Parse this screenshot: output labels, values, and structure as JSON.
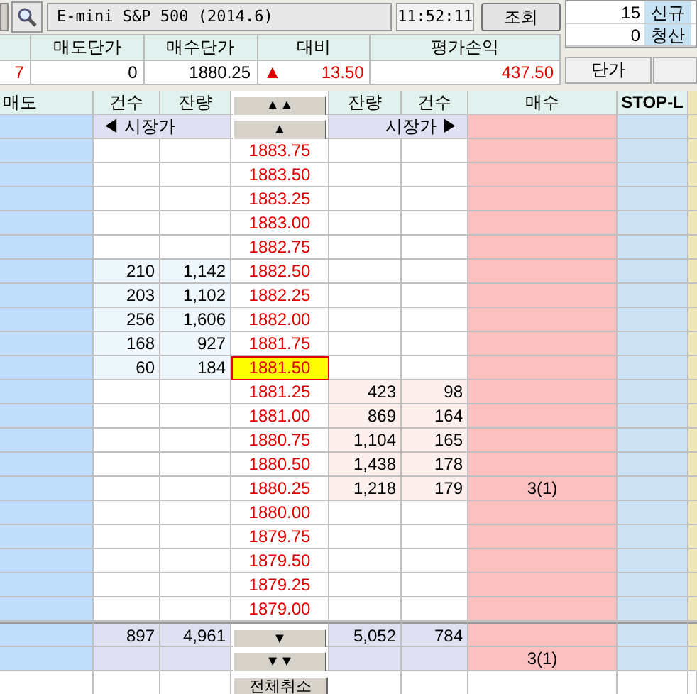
{
  "toolbar": {
    "symbol": "E-mini S&P 500 (2014.6)",
    "time": "11:52:11",
    "query_button": "조회"
  },
  "positions": [
    {
      "count": "15",
      "label": "신규"
    },
    {
      "count": "0",
      "label": "청산"
    }
  ],
  "price_button": "단가",
  "summary": {
    "columns": [
      "매도단가",
      "매수단가",
      "대비",
      "평가손익"
    ],
    "lead": "7",
    "sell_price": "0",
    "buy_price": "1880.25",
    "change_sign": "▲",
    "change": "13.50",
    "pnl": "437.50"
  },
  "book": {
    "columns": [
      "매도",
      "건수",
      "잔량",
      "잔량",
      "건수",
      "매수",
      "STOP-L"
    ],
    "up_fast": "▲▲",
    "up": "▲",
    "down": "▼",
    "down_fast": "▼▼",
    "market_sell": "◀ 시장가",
    "market_buy": "시장가 ▶",
    "rows": [
      {
        "price": "1883.75",
        "current": false
      },
      {
        "price": "1883.50",
        "current": false
      },
      {
        "price": "1883.25",
        "current": false
      },
      {
        "price": "1883.00",
        "current": false
      },
      {
        "price": "1882.75",
        "current": false
      },
      {
        "price": "1882.50",
        "current": false,
        "ask_count": "210",
        "ask_qty": "1,142"
      },
      {
        "price": "1882.25",
        "current": false,
        "ask_count": "203",
        "ask_qty": "1,102"
      },
      {
        "price": "1882.00",
        "current": false,
        "ask_count": "256",
        "ask_qty": "1,606"
      },
      {
        "price": "1881.75",
        "current": false,
        "ask_count": "168",
        "ask_qty": "927"
      },
      {
        "price": "1881.50",
        "current": true,
        "ask_count": "60",
        "ask_qty": "184"
      },
      {
        "price": "1881.25",
        "current": false,
        "bid_qty": "423",
        "bid_count": "98"
      },
      {
        "price": "1881.00",
        "current": false,
        "bid_qty": "869",
        "bid_count": "164"
      },
      {
        "price": "1880.75",
        "current": false,
        "bid_qty": "1,104",
        "bid_count": "165"
      },
      {
        "price": "1880.50",
        "current": false,
        "bid_qty": "1,438",
        "bid_count": "178"
      },
      {
        "price": "1880.25",
        "current": false,
        "bid_qty": "1,218",
        "bid_count": "179",
        "buy_order": "3(1)"
      },
      {
        "price": "1880.00",
        "current": false
      },
      {
        "price": "1879.75",
        "current": false
      },
      {
        "price": "1879.50",
        "current": false
      },
      {
        "price": "1879.25",
        "current": false
      },
      {
        "price": "1879.00",
        "current": false
      }
    ],
    "totals": {
      "ask_count": "897",
      "ask_qty": "4,961",
      "bid_qty": "5,052",
      "bid_count": "784",
      "buy_order": "3(1)"
    },
    "cancel_all": "전체취소"
  }
}
